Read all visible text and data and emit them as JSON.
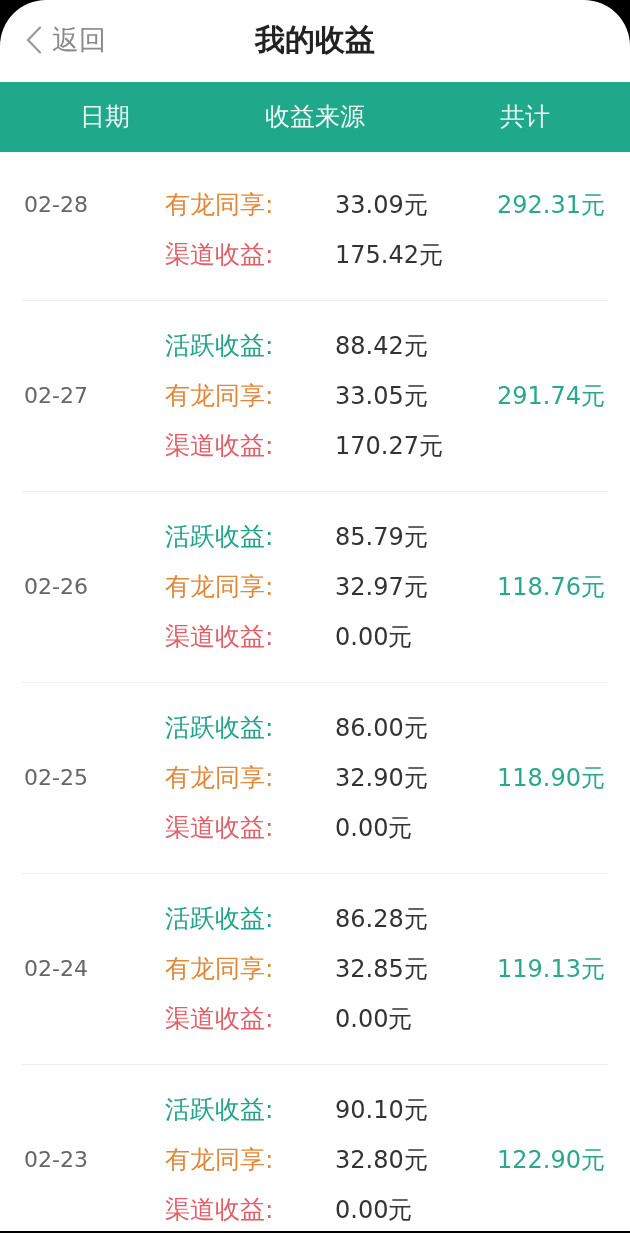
{
  "top_bar": {
    "back_label": "返回",
    "title": "我的收益"
  },
  "table": {
    "columns": [
      "日期",
      "收益来源",
      "共计"
    ],
    "rows": [
      {
        "date": "02-28",
        "sources": [
          {
            "label": "有龙同享:",
            "amount": "33.09元",
            "color": "#e2883a"
          },
          {
            "label": "渠道收益:",
            "amount": "175.42元",
            "color": "#e0606a"
          }
        ],
        "total": "292.31元"
      },
      {
        "date": "02-27",
        "sources": [
          {
            "label": "活跃收益:",
            "amount": "88.42元",
            "color": "#22a38a"
          },
          {
            "label": "有龙同享:",
            "amount": "33.05元",
            "color": "#e2883a"
          },
          {
            "label": "渠道收益:",
            "amount": "170.27元",
            "color": "#e0606a"
          }
        ],
        "total": "291.74元"
      },
      {
        "date": "02-26",
        "sources": [
          {
            "label": "活跃收益:",
            "amount": "85.79元",
            "color": "#22a38a"
          },
          {
            "label": "有龙同享:",
            "amount": "32.97元",
            "color": "#e2883a"
          },
          {
            "label": "渠道收益:",
            "amount": "0.00元",
            "color": "#e0606a"
          }
        ],
        "total": "118.76元"
      },
      {
        "date": "02-25",
        "sources": [
          {
            "label": "活跃收益:",
            "amount": "86.00元",
            "color": "#22a38a"
          },
          {
            "label": "有龙同享:",
            "amount": "32.90元",
            "color": "#e2883a"
          },
          {
            "label": "渠道收益:",
            "amount": "0.00元",
            "color": "#e0606a"
          }
        ],
        "total": "118.90元"
      },
      {
        "date": "02-24",
        "sources": [
          {
            "label": "活跃收益:",
            "amount": "86.28元",
            "color": "#22a38a"
          },
          {
            "label": "有龙同享:",
            "amount": "32.85元",
            "color": "#e2883a"
          },
          {
            "label": "渠道收益:",
            "amount": "0.00元",
            "color": "#e0606a"
          }
        ],
        "total": "119.13元"
      },
      {
        "date": "02-23",
        "sources": [
          {
            "label": "活跃收益:",
            "amount": "90.10元",
            "color": "#22a38a"
          },
          {
            "label": "有龙同享:",
            "amount": "32.80元",
            "color": "#e2883a"
          },
          {
            "label": "渠道收益:",
            "amount": "0.00元",
            "color": "#e0606a"
          }
        ],
        "total": "122.90元"
      }
    ]
  }
}
